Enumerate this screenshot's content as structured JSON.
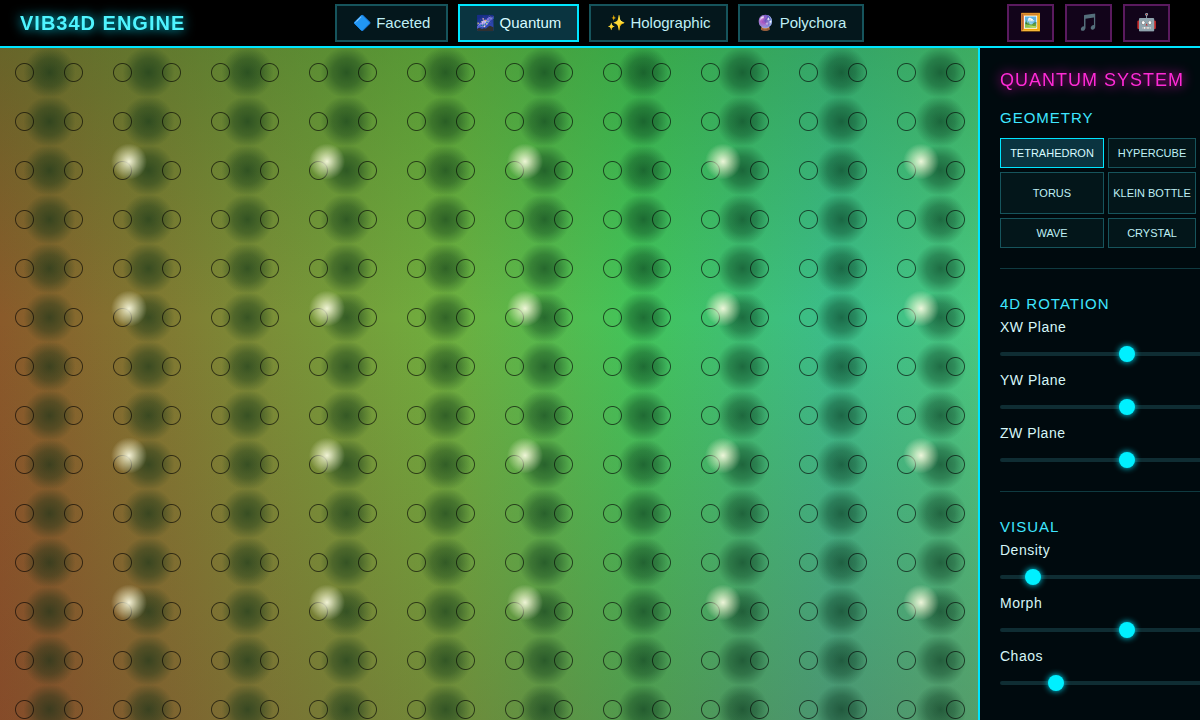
{
  "logo": "VIB34D ENGINE",
  "tabs": [
    {
      "label": "🔷 Faceted",
      "selected": false
    },
    {
      "label": "🌌 Quantum",
      "selected": true
    },
    {
      "label": "✨ Holographic",
      "selected": false
    },
    {
      "label": "🔮 Polychora",
      "selected": false
    }
  ],
  "actions": [
    {
      "icon": "🖼️"
    },
    {
      "icon": "🎵"
    },
    {
      "icon": "🤖"
    }
  ],
  "panel": {
    "title": "QUANTUM SYSTEM",
    "geometry": {
      "heading": "GEOMETRY",
      "options": [
        {
          "label": "TETRAHEDRON",
          "selected": true
        },
        {
          "label": "HYPERCUBE",
          "selected": false
        },
        {
          "label": "TORUS",
          "selected": false
        },
        {
          "label": "KLEIN BOTTLE",
          "selected": false
        },
        {
          "label": "WAVE",
          "selected": false
        },
        {
          "label": "CRYSTAL",
          "selected": false
        }
      ]
    },
    "rotation": {
      "heading": "4D ROTATION",
      "sliders": [
        {
          "label": "XW Plane",
          "level": 0.5
        },
        {
          "label": "YW Plane",
          "level": 0.5
        },
        {
          "label": "ZW Plane",
          "level": 0.5
        }
      ]
    },
    "visual": {
      "heading": "VISUAL",
      "sliders": [
        {
          "label": "Density",
          "level": 0.13
        },
        {
          "label": "Morph",
          "level": 0.5
        },
        {
          "label": "Chaos",
          "level": 0.22
        }
      ]
    }
  }
}
